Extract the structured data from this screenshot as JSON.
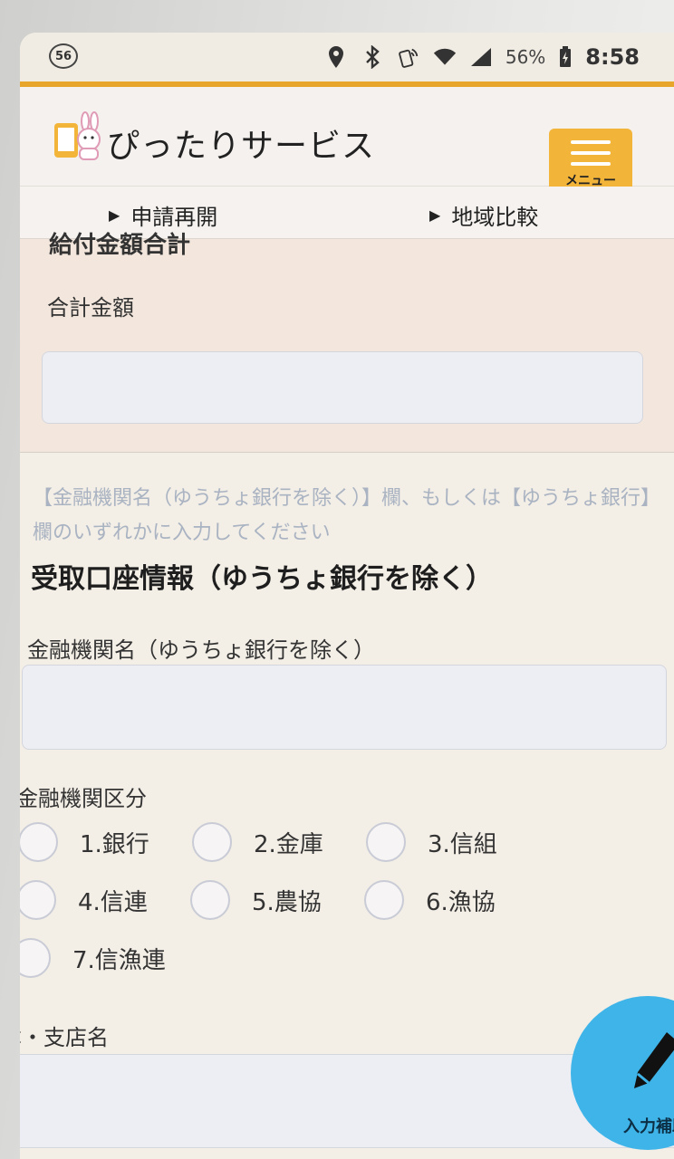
{
  "status_bar": {
    "notification_count": "56",
    "battery_percent": "56%",
    "time": "8:58"
  },
  "header": {
    "app_title": "ぴったりサービス",
    "menu_label": "メニュー"
  },
  "subnav": {
    "items": [
      {
        "label": "申請再開"
      },
      {
        "label": "地域比較"
      }
    ]
  },
  "form": {
    "cut_heading": "給付金額合計",
    "total_amount_label": "合計金額",
    "total_amount_value": "",
    "hint": "【金融機関名（ゆうちょ銀行を除く）】欄、もしくは【ゆうちょ銀行】欄のいずれかに入力してください",
    "section_title": "受取口座情報（ゆうちょ銀行を除く）",
    "bank_name_label": "金融機関名（ゆうちょ銀行を除く）",
    "bank_name_value": "",
    "bank_type_label": "金融機関区分",
    "bank_type_options": [
      {
        "label": "1.銀行"
      },
      {
        "label": "2.金庫"
      },
      {
        "label": "3.信組"
      },
      {
        "label": "4.信連"
      },
      {
        "label": "5.農協"
      },
      {
        "label": "6.漁協"
      },
      {
        "label": "7.信漁連"
      }
    ],
    "branch_label": "本・支店名",
    "branch_value": ""
  },
  "fab": {
    "label": "入力補助"
  },
  "colors": {
    "accent": "#e8a52b",
    "menu_button": "#f3b43a",
    "fab": "#3fb4e9",
    "hint_text": "#a9b3c2"
  }
}
